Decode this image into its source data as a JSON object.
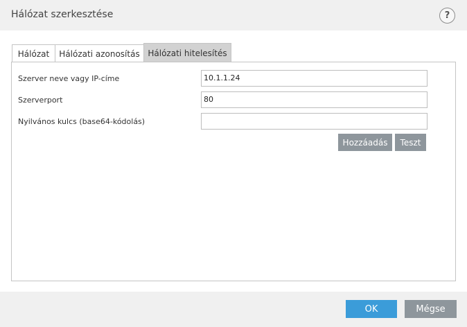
{
  "dialog": {
    "title": "Hálózat szerkesztése",
    "help_label": "?"
  },
  "tabs": [
    {
      "label": "Hálózat"
    },
    {
      "label": "Hálózati azonosítás"
    },
    {
      "label": "Hálózati hitelesítés",
      "active": true
    }
  ],
  "form": {
    "server": {
      "label": "Szerver neve vagy IP-címe",
      "value": "10.1.1.24"
    },
    "port": {
      "label": "Szerverport",
      "value": "80"
    },
    "public_key": {
      "label": "Nyilvános kulcs (base64-kódolás)",
      "value": ""
    },
    "add_label": "Hozzáadás",
    "test_label": "Teszt"
  },
  "footer": {
    "ok_label": "OK",
    "cancel_label": "Mégse"
  },
  "colors": {
    "primary_button": "#3b9cd9",
    "secondary_button": "#8e969c",
    "active_tab": "#d2d2d2"
  }
}
